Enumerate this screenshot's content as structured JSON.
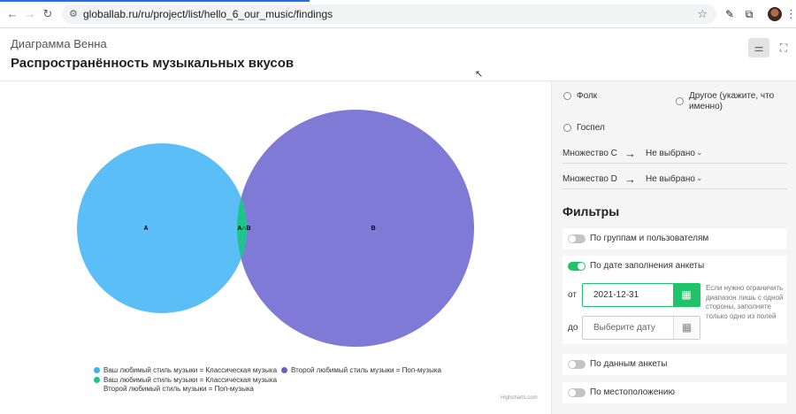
{
  "browser": {
    "url": "globallab.ru/ru/project/list/hello_6_our_music/findings",
    "back_icon": "arrow-left-icon",
    "forward_icon": "arrow-right-icon",
    "reload_icon": "reload-icon",
    "site_icon": "site-settings-icon",
    "bookmark_icon": "star-icon",
    "menu_icon": "kebab-icon"
  },
  "header": {
    "subtitle": "Диаграмма Венна",
    "title": "Распространённость музыкальных вкусов",
    "settings_icon": "sliders-icon",
    "fullscreen_icon": "fullscreen-icon"
  },
  "chart_data": {
    "type": "venn",
    "sets": [
      {
        "name": "A",
        "label": "A",
        "color": "#5bbef7"
      },
      {
        "name": "B",
        "label": "B",
        "color": "#7f7ad6"
      },
      {
        "name": "A∩B",
        "label": "A∩B",
        "color": "#1ec58a"
      }
    ],
    "legend": [
      {
        "text": "Ваш любимый стиль музыки  = Классическая музыка",
        "color": "#3fb1f0"
      },
      {
        "text": "Второй любимый стиль музыки  = Поп-музыка",
        "color": "#6b5fc7"
      },
      {
        "text": "Ваш любимый стиль музыки  = Классическая музыка",
        "text2": "Второй любимый стиль музыки  = Поп-музыка",
        "color": "#1ec58a"
      }
    ],
    "credits": "Highcharts.com"
  },
  "sidebar": {
    "options": [
      {
        "label": "Фолк"
      },
      {
        "label": "Другое (укажите, что именно)"
      },
      {
        "label": "Госпел"
      }
    ],
    "set_c": {
      "label": "Множество C",
      "value": "Не выбрано"
    },
    "set_d": {
      "label": "Множество D",
      "value": "Не выбрано"
    },
    "filters_title": "Фильтры",
    "filters": {
      "by_groups": "По группам и пользователям",
      "by_date": "По дате заполнения анкеты",
      "by_data": "По данным анкеты",
      "by_location": "По местоположению"
    },
    "date": {
      "from_label": "от",
      "from_value": "2021-12-31",
      "to_label": "до",
      "to_placeholder": "Выберите дату",
      "hint": "Если нужно ограничить диапазон лишь с одной стороны, заполните только одно из полей"
    }
  }
}
